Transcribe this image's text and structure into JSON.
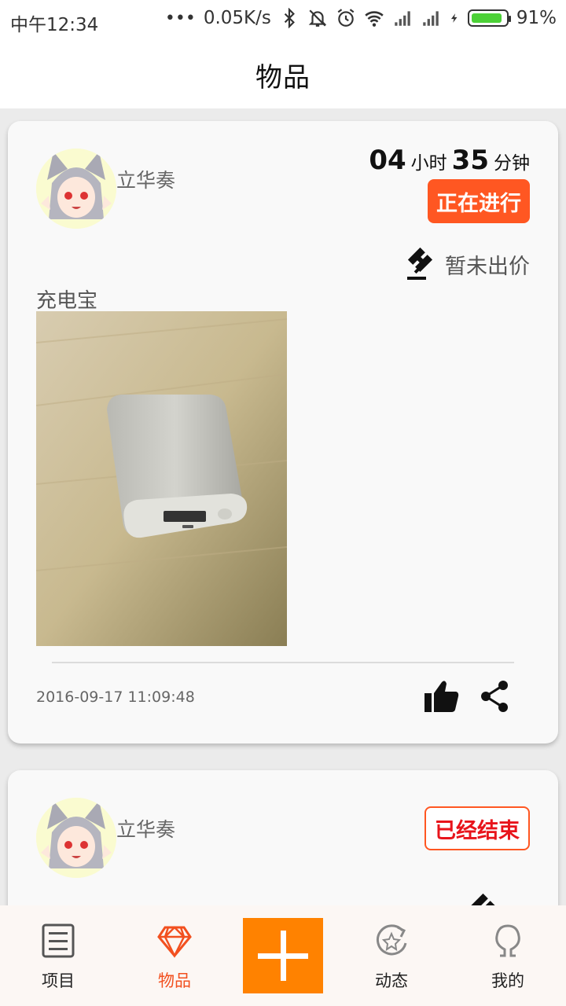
{
  "status_bar": {
    "time": "中午12:34",
    "network_speed": "0.05K/s",
    "battery_percent": "91%",
    "battery_level": 0.91,
    "icons": [
      "more-dots-icon",
      "bluetooth-icon",
      "mute-icon",
      "alarm-icon",
      "wifi-icon",
      "signal-icon",
      "signal-icon",
      "charging-icon",
      "battery-icon"
    ]
  },
  "header": {
    "title": "物品"
  },
  "cards": [
    {
      "username": "立华奏",
      "countdown": {
        "hours": "04",
        "hours_unit": "小时",
        "minutes": "35",
        "minutes_unit": "分钟"
      },
      "status": "正在进行",
      "bid_text": "暂未出价",
      "item_name": "充电宝",
      "photo_desc_icon": "power-bank-photo",
      "date": "2016-09-17 11:09:48"
    },
    {
      "username": "立华奏",
      "status": "已经结束"
    }
  ],
  "nav": {
    "items": [
      {
        "label": "项目",
        "icon": "list-icon"
      },
      {
        "label": "物品",
        "icon": "diamond-icon"
      },
      {
        "label": "",
        "icon": "plus-icon"
      },
      {
        "label": "动态",
        "icon": "star-refresh-icon"
      },
      {
        "label": "我的",
        "icon": "person-icon"
      }
    ]
  },
  "colors": {
    "accent": "#ff5722",
    "add_button": "#ff8200",
    "nav_selected": "#f2501f",
    "ended_text": "#e8141b"
  }
}
